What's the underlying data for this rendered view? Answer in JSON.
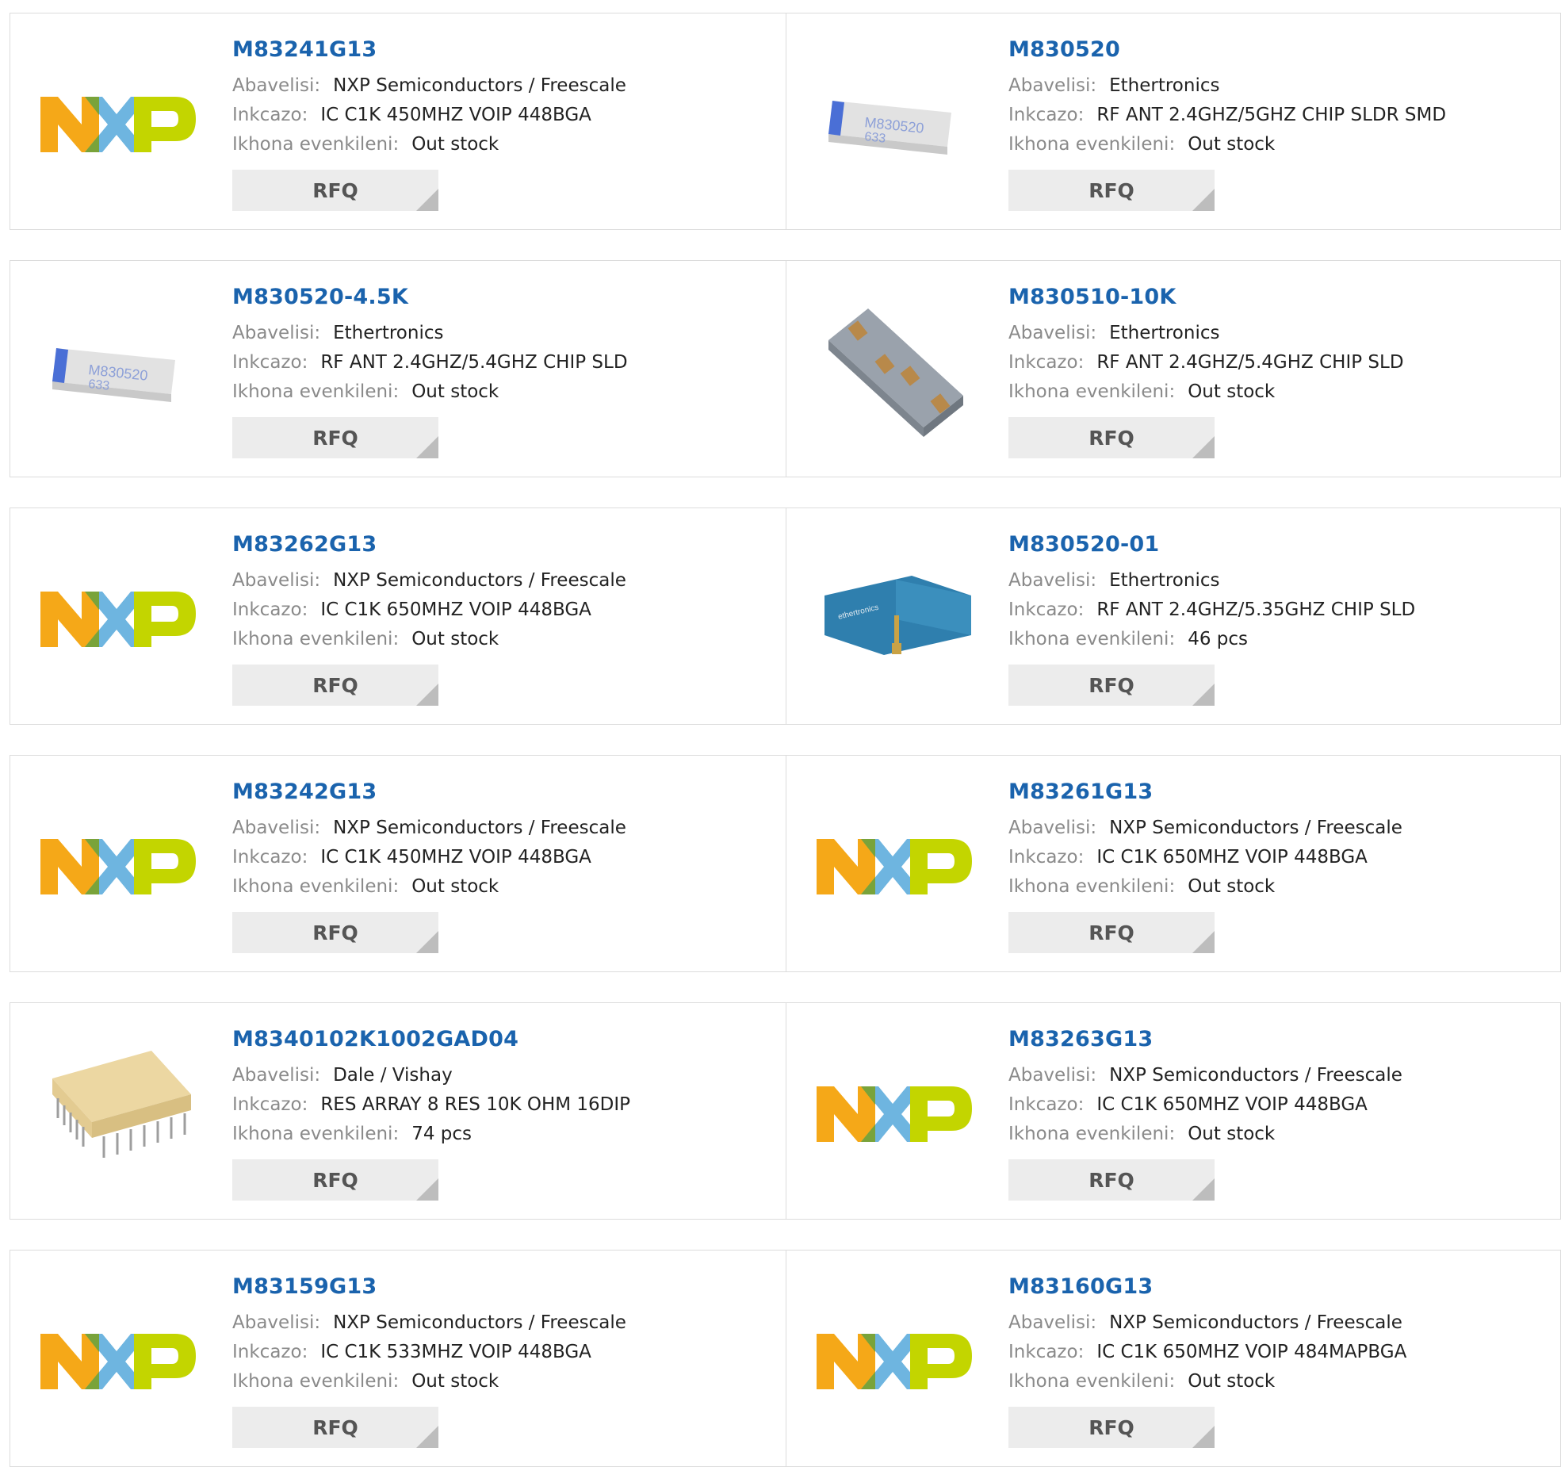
{
  "labels": {
    "manufacturer": "Abavelisi:",
    "description": "Inkcazo:",
    "stock": "Ikhona evenkileni:",
    "rfq": "RFQ"
  },
  "brand_colors": {
    "nxp_yellow": "#f5a818",
    "nxp_blue": "#6eb5e0",
    "nxp_green": "#c3d500",
    "part_number": "#1a63ad"
  },
  "rows": [
    [
      {
        "part": "M83241G13",
        "manufacturer": "NXP Semiconductors / Freescale",
        "description": "IC C1K 450MHZ VOIP 448BGA",
        "stock": "Out stock",
        "image": "nxp-logo"
      },
      {
        "part": "M830520",
        "manufacturer": "Ethertronics",
        "description": "RF ANT 2.4GHZ/5GHZ CHIP SLDR SMD",
        "stock": "Out stock",
        "image": "chip-antenna-photo"
      }
    ],
    [
      {
        "part": "M830520-4.5K",
        "manufacturer": "Ethertronics",
        "description": "RF ANT 2.4GHZ/5.4GHZ CHIP SLD",
        "stock": "Out stock",
        "image": "chip-antenna-photo"
      },
      {
        "part": "M830510-10K",
        "manufacturer": "Ethertronics",
        "description": "RF ANT 2.4GHZ/5.4GHZ CHIP SLD",
        "stock": "Out stock",
        "image": "chip-antenna-gray-photo"
      }
    ],
    [
      {
        "part": "M83262G13",
        "manufacturer": "NXP Semiconductors / Freescale",
        "description": "IC C1K 650MHZ VOIP 448BGA",
        "stock": "Out stock",
        "image": "nxp-logo"
      },
      {
        "part": "M830520-01",
        "manufacturer": "Ethertronics",
        "description": "RF ANT 2.4GHZ/5.35GHZ CHIP SLD",
        "stock": "46 pcs",
        "image": "eval-board-photo"
      }
    ],
    [
      {
        "part": "M83242G13",
        "manufacturer": "NXP Semiconductors / Freescale",
        "description": "IC C1K 450MHZ VOIP 448BGA",
        "stock": "Out stock",
        "image": "nxp-logo"
      },
      {
        "part": "M83261G13",
        "manufacturer": "NXP Semiconductors / Freescale",
        "description": "IC C1K 650MHZ VOIP 448BGA",
        "stock": "Out stock",
        "image": "nxp-logo"
      }
    ],
    [
      {
        "part": "M8340102K1002GAD04",
        "manufacturer": "Dale / Vishay",
        "description": "RES ARRAY 8 RES 10K OHM 16DIP",
        "stock": "74 pcs",
        "image": "dip-package-photo"
      },
      {
        "part": "M83263G13",
        "manufacturer": "NXP Semiconductors / Freescale",
        "description": "IC C1K 650MHZ VOIP 448BGA",
        "stock": "Out stock",
        "image": "nxp-logo"
      }
    ],
    [
      {
        "part": "M83159G13",
        "manufacturer": "NXP Semiconductors / Freescale",
        "description": "IC C1K 533MHZ VOIP 448BGA",
        "stock": "Out stock",
        "image": "nxp-logo"
      },
      {
        "part": "M83160G13",
        "manufacturer": "NXP Semiconductors / Freescale",
        "description": "IC C1K 650MHZ VOIP 484MAPBGA",
        "stock": "Out stock",
        "image": "nxp-logo"
      }
    ]
  ]
}
